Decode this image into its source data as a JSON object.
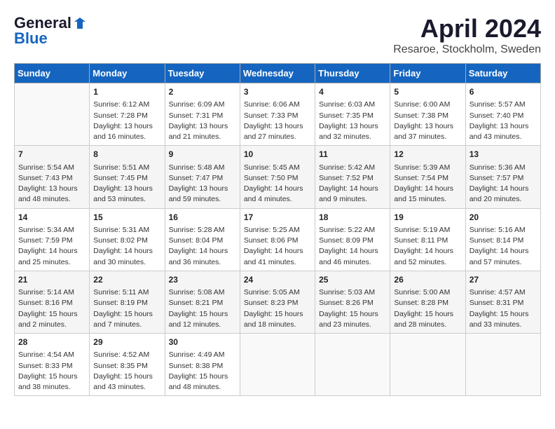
{
  "header": {
    "logo_line1": "General",
    "logo_line2": "Blue",
    "month": "April 2024",
    "location": "Resaroe, Stockholm, Sweden"
  },
  "days_of_week": [
    "Sunday",
    "Monday",
    "Tuesday",
    "Wednesday",
    "Thursday",
    "Friday",
    "Saturday"
  ],
  "weeks": [
    [
      {
        "day": "",
        "info": ""
      },
      {
        "day": "1",
        "info": "Sunrise: 6:12 AM\nSunset: 7:28 PM\nDaylight: 13 hours\nand 16 minutes."
      },
      {
        "day": "2",
        "info": "Sunrise: 6:09 AM\nSunset: 7:31 PM\nDaylight: 13 hours\nand 21 minutes."
      },
      {
        "day": "3",
        "info": "Sunrise: 6:06 AM\nSunset: 7:33 PM\nDaylight: 13 hours\nand 27 minutes."
      },
      {
        "day": "4",
        "info": "Sunrise: 6:03 AM\nSunset: 7:35 PM\nDaylight: 13 hours\nand 32 minutes."
      },
      {
        "day": "5",
        "info": "Sunrise: 6:00 AM\nSunset: 7:38 PM\nDaylight: 13 hours\nand 37 minutes."
      },
      {
        "day": "6",
        "info": "Sunrise: 5:57 AM\nSunset: 7:40 PM\nDaylight: 13 hours\nand 43 minutes."
      }
    ],
    [
      {
        "day": "7",
        "info": "Sunrise: 5:54 AM\nSunset: 7:43 PM\nDaylight: 13 hours\nand 48 minutes."
      },
      {
        "day": "8",
        "info": "Sunrise: 5:51 AM\nSunset: 7:45 PM\nDaylight: 13 hours\nand 53 minutes."
      },
      {
        "day": "9",
        "info": "Sunrise: 5:48 AM\nSunset: 7:47 PM\nDaylight: 13 hours\nand 59 minutes."
      },
      {
        "day": "10",
        "info": "Sunrise: 5:45 AM\nSunset: 7:50 PM\nDaylight: 14 hours\nand 4 minutes."
      },
      {
        "day": "11",
        "info": "Sunrise: 5:42 AM\nSunset: 7:52 PM\nDaylight: 14 hours\nand 9 minutes."
      },
      {
        "day": "12",
        "info": "Sunrise: 5:39 AM\nSunset: 7:54 PM\nDaylight: 14 hours\nand 15 minutes."
      },
      {
        "day": "13",
        "info": "Sunrise: 5:36 AM\nSunset: 7:57 PM\nDaylight: 14 hours\nand 20 minutes."
      }
    ],
    [
      {
        "day": "14",
        "info": "Sunrise: 5:34 AM\nSunset: 7:59 PM\nDaylight: 14 hours\nand 25 minutes."
      },
      {
        "day": "15",
        "info": "Sunrise: 5:31 AM\nSunset: 8:02 PM\nDaylight: 14 hours\nand 30 minutes."
      },
      {
        "day": "16",
        "info": "Sunrise: 5:28 AM\nSunset: 8:04 PM\nDaylight: 14 hours\nand 36 minutes."
      },
      {
        "day": "17",
        "info": "Sunrise: 5:25 AM\nSunset: 8:06 PM\nDaylight: 14 hours\nand 41 minutes."
      },
      {
        "day": "18",
        "info": "Sunrise: 5:22 AM\nSunset: 8:09 PM\nDaylight: 14 hours\nand 46 minutes."
      },
      {
        "day": "19",
        "info": "Sunrise: 5:19 AM\nSunset: 8:11 PM\nDaylight: 14 hours\nand 52 minutes."
      },
      {
        "day": "20",
        "info": "Sunrise: 5:16 AM\nSunset: 8:14 PM\nDaylight: 14 hours\nand 57 minutes."
      }
    ],
    [
      {
        "day": "21",
        "info": "Sunrise: 5:14 AM\nSunset: 8:16 PM\nDaylight: 15 hours\nand 2 minutes."
      },
      {
        "day": "22",
        "info": "Sunrise: 5:11 AM\nSunset: 8:19 PM\nDaylight: 15 hours\nand 7 minutes."
      },
      {
        "day": "23",
        "info": "Sunrise: 5:08 AM\nSunset: 8:21 PM\nDaylight: 15 hours\nand 12 minutes."
      },
      {
        "day": "24",
        "info": "Sunrise: 5:05 AM\nSunset: 8:23 PM\nDaylight: 15 hours\nand 18 minutes."
      },
      {
        "day": "25",
        "info": "Sunrise: 5:03 AM\nSunset: 8:26 PM\nDaylight: 15 hours\nand 23 minutes."
      },
      {
        "day": "26",
        "info": "Sunrise: 5:00 AM\nSunset: 8:28 PM\nDaylight: 15 hours\nand 28 minutes."
      },
      {
        "day": "27",
        "info": "Sunrise: 4:57 AM\nSunset: 8:31 PM\nDaylight: 15 hours\nand 33 minutes."
      }
    ],
    [
      {
        "day": "28",
        "info": "Sunrise: 4:54 AM\nSunset: 8:33 PM\nDaylight: 15 hours\nand 38 minutes."
      },
      {
        "day": "29",
        "info": "Sunrise: 4:52 AM\nSunset: 8:35 PM\nDaylight: 15 hours\nand 43 minutes."
      },
      {
        "day": "30",
        "info": "Sunrise: 4:49 AM\nSunset: 8:38 PM\nDaylight: 15 hours\nand 48 minutes."
      },
      {
        "day": "",
        "info": ""
      },
      {
        "day": "",
        "info": ""
      },
      {
        "day": "",
        "info": ""
      },
      {
        "day": "",
        "info": ""
      }
    ]
  ]
}
